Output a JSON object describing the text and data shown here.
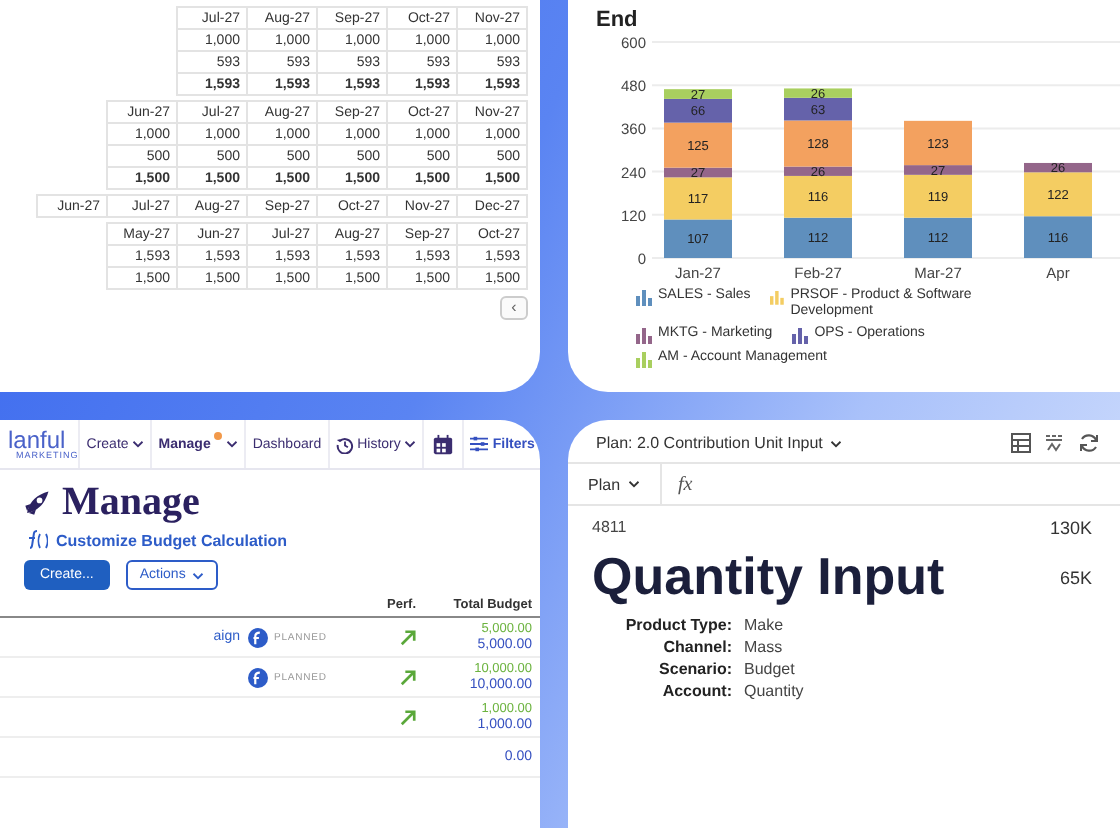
{
  "sheet": {
    "blocks": [
      {
        "months": [
          "Jul-27",
          "Aug-27",
          "Sep-27",
          "Oct-27",
          "Nov-27"
        ],
        "rows": [
          [
            "1,000",
            "1,000",
            "1,000",
            "1,000",
            "1,000"
          ],
          [
            "593",
            "593",
            "593",
            "593",
            "593"
          ]
        ],
        "totals": [
          "1,593",
          "1,593",
          "1,593",
          "1,593",
          "1,593"
        ]
      },
      {
        "months": [
          "Jun-27",
          "Jul-27",
          "Aug-27",
          "Sep-27",
          "Oct-27",
          "Nov-27"
        ],
        "rows": [
          [
            "1,000",
            "1,000",
            "1,000",
            "1,000",
            "1,000",
            "1,000"
          ],
          [
            "500",
            "500",
            "500",
            "500",
            "500",
            "500"
          ]
        ],
        "totals": [
          "1,500",
          "1,500",
          "1,500",
          "1,500",
          "1,500",
          "1,500"
        ]
      },
      {
        "months": [
          "Jun-27",
          "Jul-27",
          "Aug-27",
          "Sep-27",
          "Oct-27",
          "Nov-27",
          "Dec-27"
        ]
      },
      {
        "months": [
          "May-27",
          "Jun-27",
          "Jul-27",
          "Aug-27",
          "Sep-27",
          "Oct-27"
        ],
        "rows": [
          [
            "1,593",
            "1,593",
            "1,593",
            "1,593",
            "1,593",
            "1,593"
          ],
          [
            "1,500",
            "1,500",
            "1,500",
            "1,500",
            "1,500",
            "1,500"
          ]
        ]
      }
    ],
    "scroll_button": "‹"
  },
  "chart_panel": {
    "title": "End",
    "chart_data": {
      "type": "bar",
      "stacked": true,
      "categories": [
        "Jan-27",
        "Feb-27",
        "Mar-27",
        "Apr"
      ],
      "ylim": [
        0,
        600
      ],
      "yticks": [
        0,
        120,
        240,
        360,
        480,
        600
      ],
      "grid": true,
      "data_labels": true,
      "series": [
        {
          "name": "SALES - Sales",
          "color": "#5f8fbd",
          "values": [
            107,
            112,
            112,
            116
          ]
        },
        {
          "name": "PRSOF - Product & Software Development",
          "color": "#f4cd62",
          "values": [
            117,
            116,
            119,
            122
          ]
        },
        {
          "name": "MKTG - Marketing",
          "color": "#94668a",
          "values": [
            27,
            26,
            27,
            26
          ]
        },
        {
          "color": "#f3a15f",
          "values": [
            125,
            128,
            123,
            null
          ]
        },
        {
          "name": "OPS - Operations",
          "color": "#6562aa",
          "values": [
            66,
            63,
            null,
            null
          ]
        },
        {
          "name": "AM - Account Management",
          "color": "#a9cf5f",
          "values": [
            27,
            26,
            null,
            null
          ]
        }
      ]
    }
  },
  "manage_panel": {
    "logo": {
      "name": "lanful",
      "tagline": "MARKETING"
    },
    "nav": [
      {
        "label": "Create",
        "kind": "menu",
        "selected": false
      },
      {
        "label": "Manage",
        "kind": "menu",
        "selected": true
      },
      {
        "label": "Dashboard",
        "kind": "link",
        "selected": false
      },
      {
        "label": "History",
        "kind": "history",
        "selected": false
      }
    ],
    "filters": "Filters",
    "heading": "Manage",
    "link": "Customize Budget Calculation",
    "create_button": "Create...",
    "actions_button": "Actions",
    "columns": [
      "Perf.",
      "Total Budget"
    ],
    "rows": [
      {
        "name": "aign",
        "status": "PLANNED",
        "trend_up": true,
        "planned": "5,000.00",
        "actual": "5,000.00"
      },
      {
        "status": "PLANNED",
        "trend_up": true,
        "planned": "10,000.00",
        "actual": "10,000.00"
      },
      {
        "trend_up": true,
        "planned": "1,000.00",
        "actual": "1,000.00"
      },
      {
        "trend_up": false,
        "actual": "0.00"
      }
    ]
  },
  "quantity_panel": {
    "plan_title": "Plan: 2.0 Contribution Unit Input",
    "plan_label": "Plan",
    "formula_symbol": "fx",
    "cell_ref": "4811",
    "title": "Quantity Input",
    "fields": [
      {
        "label": "Product Type:",
        "value": "Make"
      },
      {
        "label": "Channel:",
        "value": "Mass"
      },
      {
        "label": "Scenario:",
        "value": "Budget"
      },
      {
        "label": "Account:",
        "value": "Quantity"
      }
    ],
    "values": [
      "130K",
      "65K"
    ]
  }
}
